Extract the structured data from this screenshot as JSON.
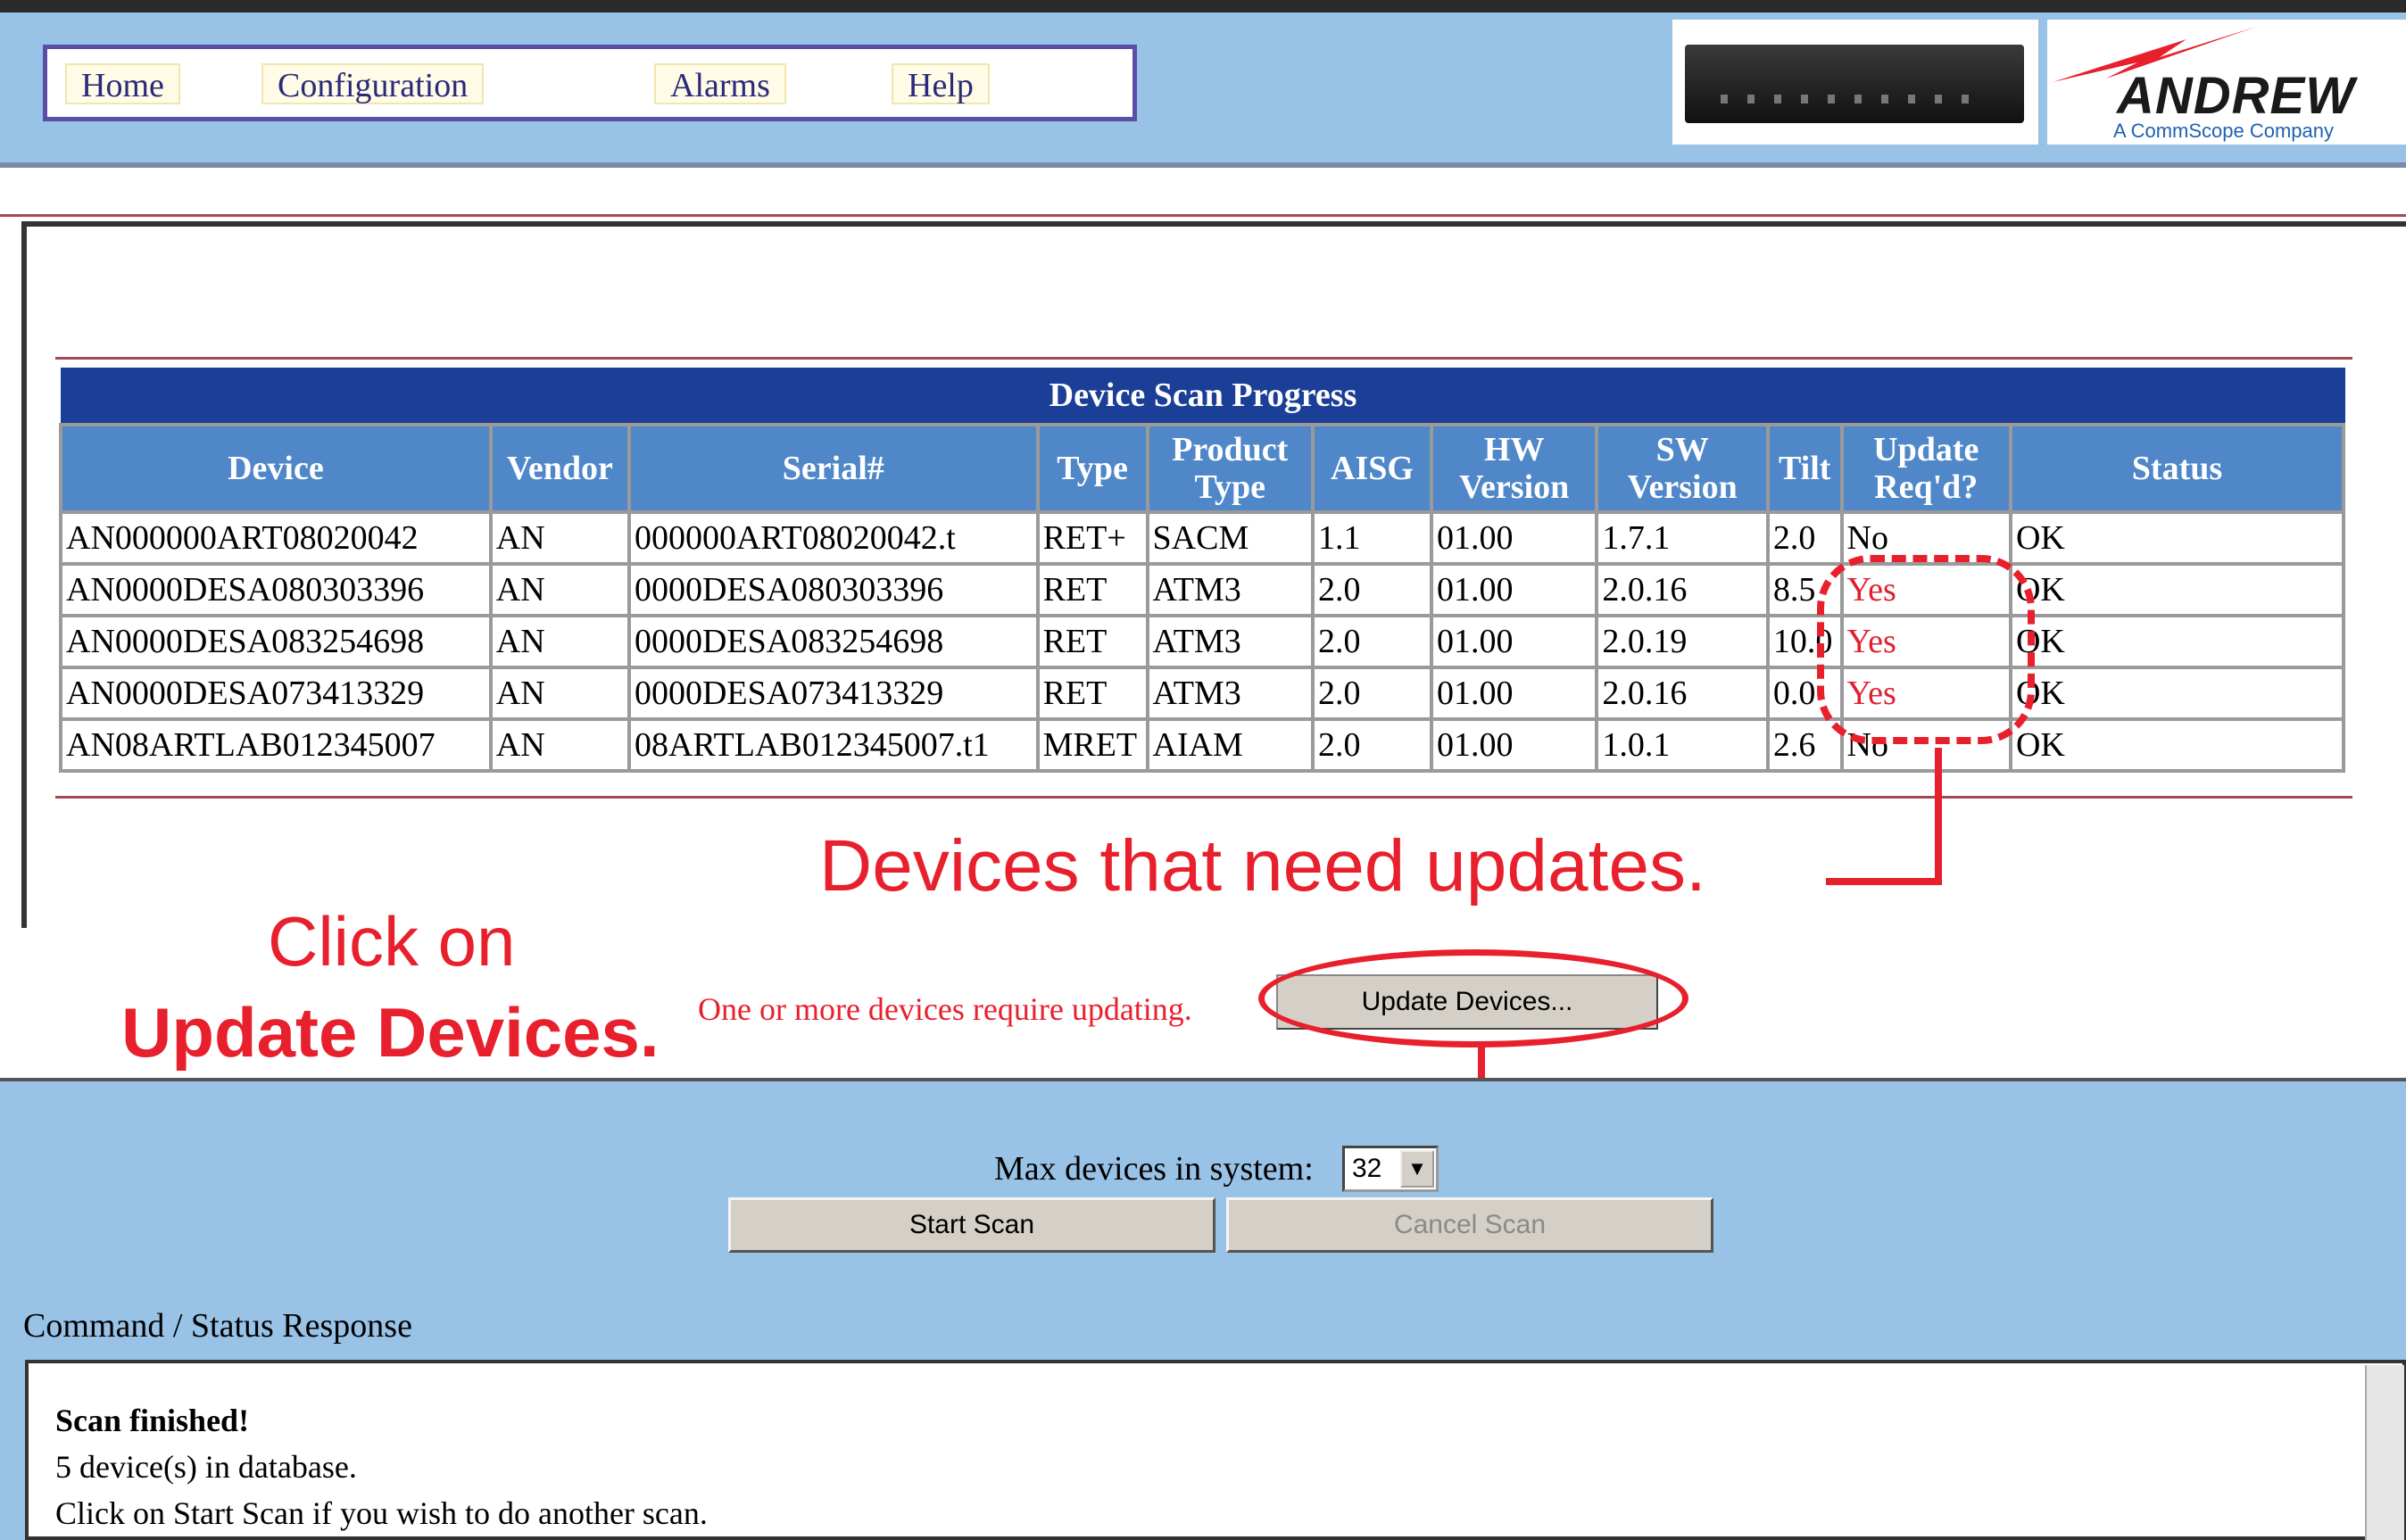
{
  "nav": {
    "items": [
      {
        "label": "Home"
      },
      {
        "label": "Configuration"
      },
      {
        "label": "Alarms"
      },
      {
        "label": "Help"
      }
    ]
  },
  "brand": {
    "name": "ANDREW",
    "tagline": "A CommScope Company",
    "accent_color": "#e8202d"
  },
  "scan": {
    "title": "Device Scan Progress",
    "headers": [
      "Device",
      "Vendor",
      "Serial#",
      "Type",
      "Product Type",
      "AISG",
      "HW Version",
      "SW Version",
      "Tilt",
      "Update Req'd?",
      "Status"
    ],
    "rows": [
      [
        "AN000000ART08020042",
        "AN",
        "000000ART08020042.t",
        "RET+",
        "SACM",
        "1.1",
        "01.00",
        "1.7.1",
        "2.0",
        "No",
        "OK"
      ],
      [
        "AN0000DESA080303396",
        "AN",
        "0000DESA080303396",
        "RET",
        "ATM3",
        "2.0",
        "01.00",
        "2.0.16",
        "8.5",
        "Yes",
        "OK"
      ],
      [
        "AN0000DESA083254698",
        "AN",
        "0000DESA083254698",
        "RET",
        "ATM3",
        "2.0",
        "01.00",
        "2.0.19",
        "10.0",
        "Yes",
        "OK"
      ],
      [
        "AN0000DESA073413329",
        "AN",
        "0000DESA073413329",
        "RET",
        "ATM3",
        "2.0",
        "01.00",
        "2.0.16",
        "0.0",
        "Yes",
        "OK"
      ],
      [
        "AN08ARTLAB012345007",
        "AN",
        "08ARTLAB012345007.t1",
        "MRET",
        "AIAM",
        "2.0",
        "01.00",
        "1.0.1",
        "2.6",
        "No",
        "OK"
      ]
    ]
  },
  "annotations": {
    "devices_need_updates": "Devices that need updates.",
    "click_on": "Click on",
    "update_devices": "Update Devices."
  },
  "update": {
    "message": "One or more devices require updating.",
    "button_label": "Update Devices..."
  },
  "controls": {
    "max_devices_label": "Max devices in system:",
    "max_devices_value": "32",
    "start_scan": "Start Scan",
    "cancel_scan": "Cancel Scan"
  },
  "response": {
    "label": "Command / Status Response",
    "lines": [
      "Scan finished!",
      "5 device(s) in database.",
      "Click on Start Scan if you wish to do another scan."
    ]
  }
}
